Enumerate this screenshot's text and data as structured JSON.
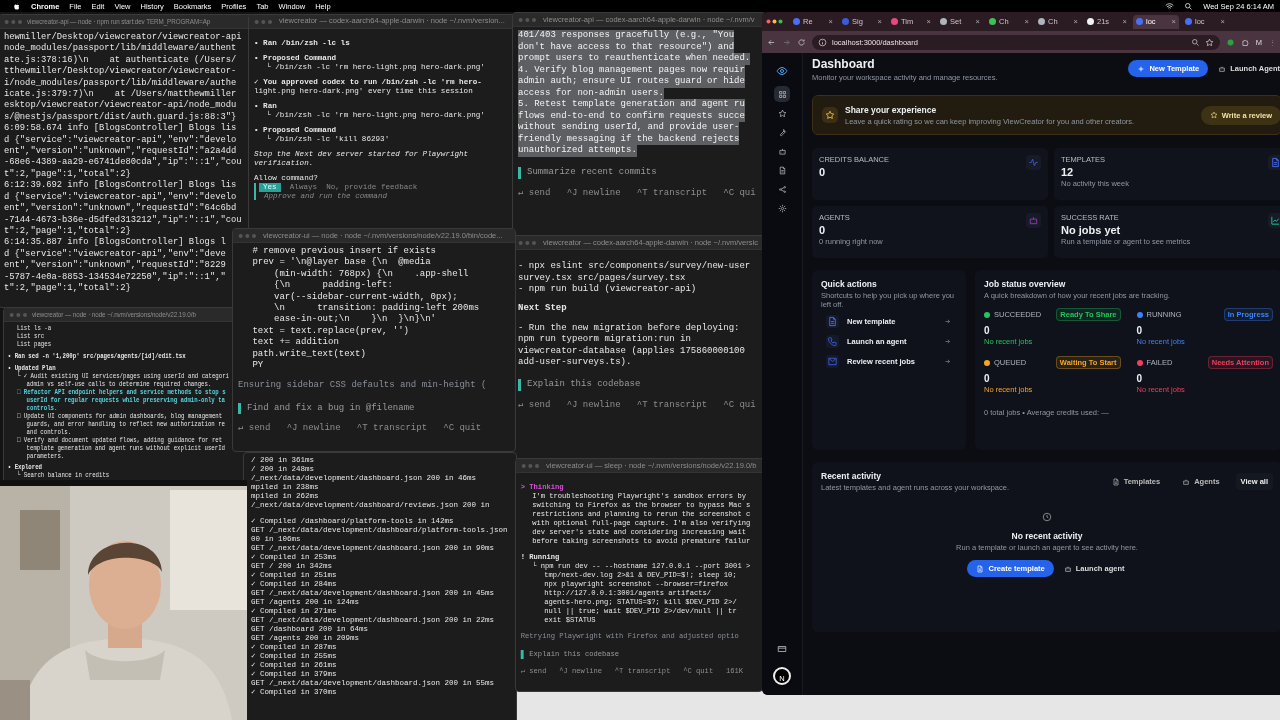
{
  "menu_bar": {
    "app": "Chrome",
    "items": [
      "File",
      "Edit",
      "View",
      "History",
      "Bookmarks",
      "Profiles",
      "Tab",
      "Window",
      "Help"
    ],
    "clock": "Wed Sep 24  6:14 AM"
  },
  "windows": [
    {
      "title": "viewcreator-api — node · npm run start:dev TERM_PROGRAM=Ap",
      "lines": [
        {
          "text": "hewmiller/Desktop/viewcreator/viewcreator-api",
          "kind": "text"
        },
        {
          "text": "node_modules/passport/lib/middleware/authent",
          "kind": "text"
        },
        {
          "text": "ate.js:378:16)\\n    at authenticate (/Users/",
          "kind": "text"
        },
        {
          "text": "tthewmiller/Desktop/viewcreator/viewcreator-",
          "kind": "text"
        },
        {
          "text": "i/node_modules/passport/lib/middleware/authe",
          "kind": "text"
        },
        {
          "text": "icate.js:379:7)\\n    at /Users/matthewmiller",
          "kind": "text"
        },
        {
          "text": "esktop/viewcreator/viewcreator-api/node_modu",
          "kind": "text"
        },
        {
          "text": "s/@nestjs/passport/dist/auth.guard.js:88:3\"}",
          "kind": "text"
        },
        {
          "text": "6:09:58.674 info [BlogsController] Blogs lis",
          "kind": "text"
        },
        {
          "text": "d {\"service\":\"viewcreator-api\",\"env\":\"develo",
          "kind": "text"
        },
        {
          "text": "ent\",\"version\":\"unknown\",\"requestId\":\"a2a4dd",
          "kind": "text"
        },
        {
          "text": "-68e6-4389-aa29-e6741de80cda\",\"ip\":\"::1\",\"cou",
          "kind": "text"
        },
        {
          "text": "t\":2,\"page\":1,\"total\":2}",
          "kind": "text"
        },
        {
          "text": "6:12:39.692 info [BlogsController] Blogs lis",
          "kind": "text"
        },
        {
          "text": "d {\"service\":\"viewcreator-api\",\"env\":\"develo",
          "kind": "text"
        },
        {
          "text": "ent\",\"version\":\"unknown\",\"requestId\":\"64c6bd",
          "kind": "text"
        },
        {
          "text": "-7144-4673-b36e-d5dfed313212\",\"ip\":\"::1\",\"cou",
          "kind": "text"
        },
        {
          "text": "t\":2,\"page\":1,\"total\":2}",
          "kind": "text"
        },
        {
          "text": "6:14:35.887 info [BlogsController] Blogs l",
          "kind": "text"
        },
        {
          "text": "d {\"service\":\"viewcreator-api\",\"env\":\"deve",
          "kind": "text"
        },
        {
          "text": "ent\",\"version\":\"unknown\",\"requestId\":\"8229",
          "kind": "text"
        },
        {
          "text": "-5787-4e0a-8853-134534e72250\",\"ip\":\"::1\",\"",
          "kind": "text"
        },
        {
          "text": "t\":2,\"page\":1,\"total\":2}",
          "kind": "text"
        }
      ]
    },
    {
      "title": "viewcreator — codex-aarch64-apple-darwin · node ~/.nvm/version...",
      "lines": [
        {
          "text": "• Ran /bin/zsh -lc ls",
          "kind": "head"
        },
        {
          "text": "• Proposed Command",
          "kind": "head"
        },
        {
          "text": "└ /bin/zsh -lc 'rm hero-light.png hero-dark.png'",
          "kind": "sub"
        },
        {
          "text": "✓ You approved codex to run /bin/zsh -lc 'rm hero-",
          "kind": "head"
        },
        {
          "text": "light.png hero-dark.png' every time this session",
          "kind": "text"
        },
        {
          "text": "• Ran",
          "kind": "head"
        },
        {
          "text": "└ /bin/zsh -lc 'rm hero-light.png hero-dark.png'",
          "kind": "sub"
        },
        {
          "text": "• Proposed Command",
          "kind": "head"
        },
        {
          "text": "└ /bin/zsh -lc 'kill 86293'",
          "kind": "sub"
        },
        {
          "text": "Stop the Next dev server started for Playwright",
          "kind": "italic"
        },
        {
          "text": "verification.",
          "kind": "italic_cont"
        },
        {
          "text": "Allow command?",
          "kind": "para"
        }
      ],
      "choices": [
        {
          "label": "Yes",
          "selected": true
        },
        {
          "label": "Always",
          "selected": false
        },
        {
          "label": "No, provide feedback",
          "selected": false
        }
      ],
      "hint": "Approve and run the command"
    },
    {
      "title": "viewcreator-api — codex-aarch64-apple-darwin · node ~/.nvm/v",
      "lines": [
        {
          "text": "401/403 responses gracefully (e.g., \"You",
          "kind": "selected"
        },
        {
          "text": "don't have access to that resource\") and",
          "kind": "selected"
        },
        {
          "text": "prompt users to reauthenticate when needed.",
          "kind": "selected"
        },
        {
          "text": "4. Verify blog management pages now requir",
          "kind": "selected"
        },
        {
          "text": "admin auth; ensure UI routes guard or hide",
          "kind": "selected"
        },
        {
          "text": "access for non-admin users.",
          "kind": "selected"
        },
        {
          "text": "5. Retest template generation and agent ru",
          "kind": "selected"
        },
        {
          "text": "flows end-to-end to confirm requests succe",
          "kind": "selected"
        },
        {
          "text": "without sending userId, and provide user-",
          "kind": "selected"
        },
        {
          "text": "friendly messaging if the backend rejects",
          "kind": "selected"
        },
        {
          "text": "unauthorized attempts.",
          "kind": "selected"
        }
      ],
      "prompt": "Summarize recent commits",
      "footer": "↵ send   ^J newline   ^T transcript   ^C qui"
    },
    {
      "title": "viewcreator — node · node ~/.nvm/versions/node/v22.19.0/b",
      "lines": [
        {
          "text": "List ls -a",
          "kind": "sub"
        },
        {
          "text": "List src",
          "kind": "sub"
        },
        {
          "text": "List pages",
          "kind": "sub"
        },
        {
          "text": "• Ran sed -n '1,200p' src/pages/agents/[id]/edit.tsx",
          "kind": "head"
        },
        {
          "text": "• Updated Plan",
          "kind": "head"
        },
        {
          "text": "└ ✓ Audit existing UI services/pages using userId and categori",
          "kind": "sub"
        },
        {
          "text": "admin vs self-use calls to determine required changes.",
          "kind": "sub2"
        },
        {
          "text": "□ Refactor API endpoint helpers and service methods to stop s",
          "kind": "cyan"
        },
        {
          "text": "userId for regular requests while preserving admin-only ta",
          "kind": "cyan2"
        },
        {
          "text": "controls.",
          "kind": "cyan2"
        },
        {
          "text": "□ Update UI components for admin dashboards, blog management",
          "kind": "sub"
        },
        {
          "text": "guards, and error handling to reflect new authorization re",
          "kind": "sub2"
        },
        {
          "text": "and controls.",
          "kind": "sub2"
        },
        {
          "text": "□ Verify and document updated flows, adding guidance for ret",
          "kind": "sub"
        },
        {
          "text": "template generation and agent runs without explicit userId",
          "kind": "sub2"
        },
        {
          "text": "parameters.",
          "kind": "sub2"
        },
        {
          "text": "• Explored",
          "kind": "head"
        },
        {
          "text": "└ Search balance in credits",
          "kind": "sub"
        }
      ]
    },
    {
      "title": "viewcreator-ui — node · node ~/.nvm/versions/node/v22.19.0/bin/code...",
      "lines": [
        {
          "text": "# remove previous insert if exists",
          "kind": "sub"
        },
        {
          "text": "prev = '\\n@layer base {\\n  @media",
          "kind": "sub"
        },
        {
          "text": "    (min-width: 768px) {\\n    .app-shell",
          "kind": "sub"
        },
        {
          "text": "    {\\n      padding-left:",
          "kind": "sub"
        },
        {
          "text": "    var(--sidebar-current-width, 0px);",
          "kind": "sub"
        },
        {
          "text": "    \\n      transition: padding-left 200ms",
          "kind": "sub"
        },
        {
          "text": "    ease-in-out;\\n    }\\n  }\\n}\\n'",
          "kind": "sub"
        },
        {
          "text": "text = text.replace(prev, '')",
          "kind": "sub"
        },
        {
          "text": "text += addition",
          "kind": "sub"
        },
        {
          "text": "path.write_text(text)",
          "kind": "sub"
        },
        {
          "text": "PY",
          "kind": "sub"
        },
        {
          "text": "Ensuring sidebar CSS defaults and min-height (",
          "kind": "dim_para"
        }
      ],
      "prompt": "Find and fix a bug in @filename",
      "footer": "↵ send   ^J newline   ^T transcript   ^C quit"
    },
    {
      "title": "viewcreator — codex-aarch64-apple-darwin · node ~/.nvm/versic",
      "lines": [
        {
          "text": "- npx eslint src/components/survey/new-user",
          "kind": "para"
        },
        {
          "text": "survey.tsx src/pages/survey.tsx",
          "kind": "text"
        },
        {
          "text": "- npm run build (viewcreator-api)",
          "kind": "text"
        },
        {
          "text": "Next Step",
          "kind": "head"
        },
        {
          "text": "- Run the new migration before deploying:",
          "kind": "para"
        },
        {
          "text": "npm run typeorm migration:run in",
          "kind": "text"
        },
        {
          "text": "viewcreator-database (applies 175860000100",
          "kind": "text"
        },
        {
          "text": "add-user-surveys.ts).",
          "kind": "text"
        }
      ],
      "prompt": "Explain this codebase",
      "footer": "↵ send   ^J newline   ^T transcript   ^C qui"
    },
    {
      "lines": [
        {
          "text": "/ 200 in 361ms",
          "kind": "text"
        },
        {
          "text": "/ 200 in 248ms",
          "kind": "text"
        },
        {
          "text": "/_next/data/development/dashboard.json 200 in 46ms",
          "kind": "text"
        },
        {
          "text": "mpiled in 238ms",
          "kind": "text"
        },
        {
          "text": "mpiled in 262ms",
          "kind": "text"
        },
        {
          "text": "/_next/data/development/dashboard/reviews.json 200 in",
          "kind": "text"
        },
        {
          "text": "✓ Compiled /dashboard/platform-tools in 142ms",
          "kind": "para"
        },
        {
          "text": "GET /_next/data/development/dashboard/platform-tools.json",
          "kind": "text"
        },
        {
          "text": "00 in 106ms",
          "kind": "text"
        },
        {
          "text": "GET /_next/data/development/dashboard.json 200 in 90ms",
          "kind": "text"
        },
        {
          "text": "✓ Compiled in 253ms",
          "kind": "text"
        },
        {
          "text": "GET / 200 in 342ms",
          "kind": "text"
        },
        {
          "text": "✓ Compiled in 251ms",
          "kind": "text"
        },
        {
          "text": "✓ Compiled in 284ms",
          "kind": "text"
        },
        {
          "text": "GET /_next/data/development/dashboard.json 200 in 45ms",
          "kind": "text"
        },
        {
          "text": "GET /agents 200 in 124ms",
          "kind": "text"
        },
        {
          "text": "✓ Compiled in 271ms",
          "kind": "text"
        },
        {
          "text": "GET /_next/data/development/dashboard.json 200 in 22ms",
          "kind": "text"
        },
        {
          "text": "GET /dashboard 200 in 64ms",
          "kind": "text"
        },
        {
          "text": "GET /agents 200 in 209ms",
          "kind": "text"
        },
        {
          "text": "✓ Compiled in 287ms",
          "kind": "text"
        },
        {
          "text": "✓ Compiled in 255ms",
          "kind": "text"
        },
        {
          "text": "✓ Compiled in 261ms",
          "kind": "text"
        },
        {
          "text": "✓ Compiled in 379ms",
          "kind": "text"
        },
        {
          "text": "GET /_next/data/development/dashboard.json 200 in 55ms",
          "kind": "text"
        },
        {
          "text": "✓ Compiled in 370ms",
          "kind": "text"
        }
      ]
    },
    {
      "title": "viewcreator-ui — sleep · node ~/.nvm/versions/node/v22.19.0/b",
      "lines": [
        {
          "text": "> Thinking",
          "kind": "magenta"
        },
        {
          "text": "I'm troubleshooting Playwright's sandbox errors by",
          "kind": "sub"
        },
        {
          "text": "switching to Firefox as the browser to bypass Mac s",
          "kind": "sub"
        },
        {
          "text": "restrictions and planning to rerun the screenshot c",
          "kind": "sub"
        },
        {
          "text": "with optional full-page capture. I'm also verifying",
          "kind": "sub"
        },
        {
          "text": "dev server's state and considering increasing wait",
          "kind": "sub"
        },
        {
          "text": "before taking screenshots to avoid premature failur",
          "kind": "sub"
        },
        {
          "text": "! Running",
          "kind": "head"
        },
        {
          "text": "└ npm run dev -- --hostname 127.0.0.1 --port 3001 >",
          "kind": "sub"
        },
        {
          "text": "tmp/next-dev.log 2>&1 & DEV_PID=$!; sleep 10;",
          "kind": "sub2"
        },
        {
          "text": "npx playwright screenshot --browser=firefox",
          "kind": "sub2"
        },
        {
          "text": "http://127.0.0.1:3001/agents artifacts/",
          "kind": "sub2"
        },
        {
          "text": "agents-hero.png; STATUS=$?; kill $DEV_PID 2>/",
          "kind": "sub2"
        },
        {
          "text": "null || true; wait $DEV_PID 2>/dev/null || tr",
          "kind": "sub2"
        },
        {
          "text": "exit $STATUS",
          "kind": "sub2"
        },
        {
          "text": "Retrying Playwright with Firefox and adjusted optio",
          "kind": "dim_para"
        }
      ],
      "prompt": "Explain this codebase",
      "footer": "↵ send   ^J newline   ^T transcript   ^C quit   161K"
    }
  ],
  "browser": {
    "tabs": [
      {
        "label": "Re",
        "close": "×",
        "selected": false,
        "color": "#4c6ef5"
      },
      {
        "label": "Sig",
        "close": "×",
        "selected": false,
        "color": "#3b5bdb"
      },
      {
        "label": "Tim",
        "close": "×",
        "selected": false,
        "color": "#e64980"
      },
      {
        "label": "Set",
        "close": "×",
        "selected": false,
        "color": "#adb5bd"
      },
      {
        "label": "Ch",
        "close": "×",
        "selected": false,
        "color": "#40c057"
      },
      {
        "label": "Ch",
        "close": "×",
        "selected": false,
        "color": "#adb5bd"
      },
      {
        "label": "21s",
        "close": "×",
        "selected": false,
        "color": "#f1f3f5"
      },
      {
        "label": "loc",
        "close": "×",
        "selected": true,
        "color": "#4c6ef5"
      },
      {
        "label": "loc",
        "close": "×",
        "selected": false,
        "color": "#4c6ef5"
      }
    ],
    "url": "localhost:3000/dashboard",
    "profile": "M"
  },
  "sidebar": {
    "items": [
      {
        "kind": "grid",
        "selected": true
      },
      {
        "kind": "star",
        "selected": false
      },
      {
        "kind": "wrench",
        "selected": false
      },
      {
        "kind": "robot",
        "selected": false
      },
      {
        "kind": "document",
        "selected": false
      },
      {
        "kind": "share",
        "selected": false
      },
      {
        "kind": "gear",
        "selected": false
      }
    ],
    "avatar": "N"
  },
  "header": {
    "title": "Dashboard",
    "subtitle": "Monitor your workspace activity and manage resources.",
    "primary_button": "New Template",
    "secondary_button": "Launch Agent"
  },
  "banner": {
    "title": "Share your experience",
    "text": "Leave a quick rating so we can keep improving ViewCreator for you and other creators.",
    "button": "Write a review"
  },
  "stats": [
    {
      "label": "CREDITS BALANCE",
      "value": "0",
      "kind": "pulse"
    },
    {
      "label": "TEMPLATES",
      "value": "12",
      "note": "No activity this week",
      "kind": "document"
    },
    {
      "label": "AGENTS",
      "value": "0",
      "note": "0 running right now",
      "kind": "robot"
    },
    {
      "label": "SUCCESS RATE",
      "value": "No jobs yet",
      "note": "Run a template or agent to see metrics",
      "kind": "chart"
    }
  ],
  "quick_actions": {
    "title": "Quick actions",
    "text": "Shortcuts to help you pick up where you left off.",
    "items": [
      {
        "label": "New template",
        "kind": "document"
      },
      {
        "label": "Launch an agent",
        "kind": "phone"
      },
      {
        "label": "Review recent jobs",
        "kind": "mail"
      }
    ]
  },
  "job_status": {
    "title": "Job status overview",
    "text": "A quick breakdown of how your recent jobs are tracking.",
    "statuses": [
      {
        "label": "SUCCEEDED",
        "badge": "Ready To Share",
        "count": "0",
        "note": "No recent jobs",
        "color": "#22c55e"
      },
      {
        "label": "RUNNING",
        "badge": "In Progress",
        "count": "0",
        "note": "No recent jobs",
        "color": "#3b82f6"
      },
      {
        "label": "QUEUED",
        "badge": "Waiting To Start",
        "count": "0",
        "note": "No recent jobs",
        "color": "#f5a623"
      },
      {
        "label": "FAILED",
        "badge": "Needs Attention",
        "count": "0",
        "note": "No recent jobs",
        "color": "#f03e5e"
      }
    ],
    "footer": "0 total jobs • Average credits used: —"
  },
  "recent_activity": {
    "title": "Recent activity",
    "text": "Latest templates and agent runs across your workspace.",
    "filters": [
      {
        "label": "Templates",
        "kind": "document"
      },
      {
        "label": "Agents",
        "kind": "robot"
      }
    ],
    "view_all": "View all",
    "empty_title": "No recent activity",
    "empty_text": "Run a template or launch an agent to see activity here.",
    "primary_button": "Create template",
    "secondary_button": "Launch agent"
  }
}
